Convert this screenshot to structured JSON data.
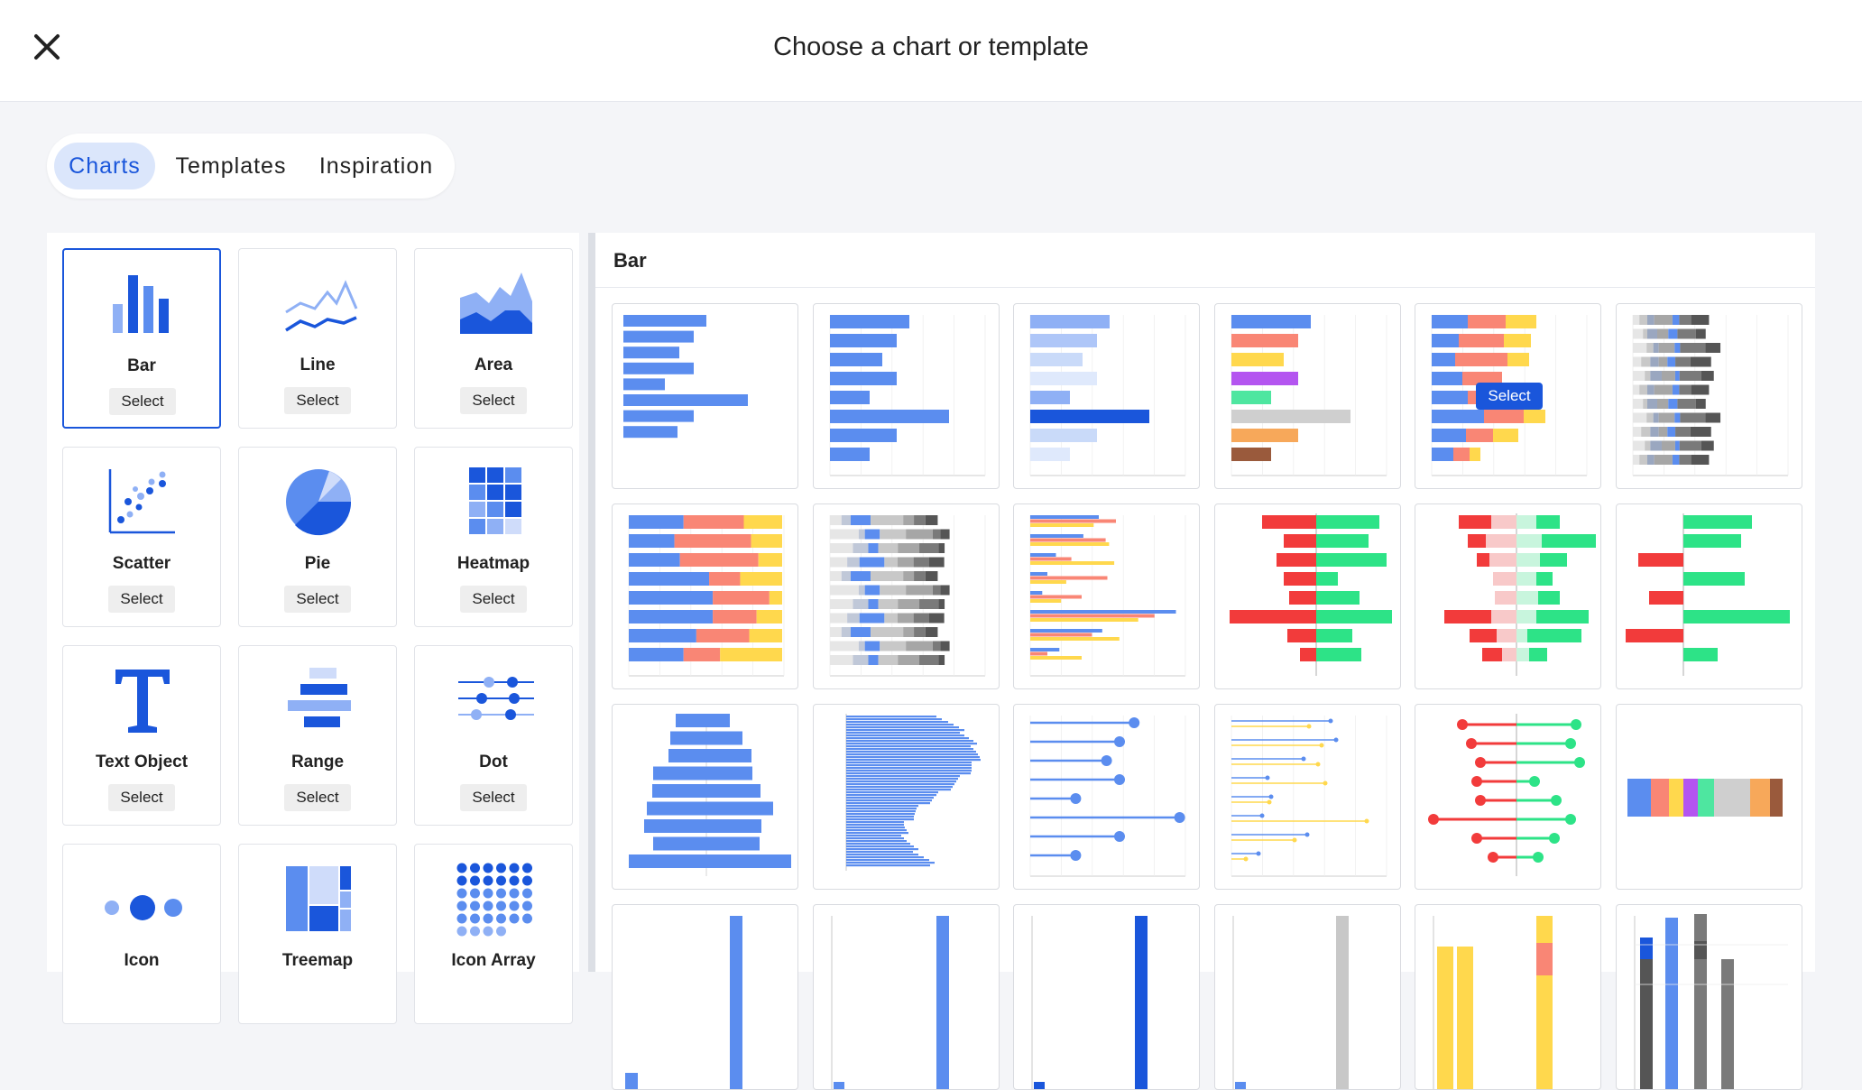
{
  "header": {
    "title": "Choose a chart or template"
  },
  "tabs": [
    {
      "label": "Charts",
      "active": true
    },
    {
      "label": "Templates",
      "active": false
    },
    {
      "label": "Inspiration",
      "active": false
    }
  ],
  "chart_types": [
    {
      "label": "Bar",
      "select_label": "Select",
      "selected": true,
      "icon": "bar-chart-icon"
    },
    {
      "label": "Line",
      "select_label": "Select",
      "icon": "line-chart-icon"
    },
    {
      "label": "Area",
      "select_label": "Select",
      "icon": "area-chart-icon"
    },
    {
      "label": "Scatter",
      "select_label": "Select",
      "icon": "scatter-chart-icon"
    },
    {
      "label": "Pie",
      "select_label": "Select",
      "icon": "pie-chart-icon"
    },
    {
      "label": "Heatmap",
      "select_label": "Select",
      "icon": "heatmap-icon"
    },
    {
      "label": "Text Object",
      "select_label": "Select",
      "icon": "text-object-icon"
    },
    {
      "label": "Range",
      "select_label": "Select",
      "icon": "range-chart-icon"
    },
    {
      "label": "Dot",
      "select_label": "Select",
      "icon": "dot-chart-icon"
    },
    {
      "label": "Icon",
      "icon": "icon-chart-icon"
    },
    {
      "label": "Treemap",
      "icon": "treemap-icon"
    },
    {
      "label": "Icon Array",
      "icon": "icon-array-icon"
    }
  ],
  "gallery": {
    "title": "Bar",
    "hover_select_label": "Select",
    "templates": [
      {
        "name": "simple-bar"
      },
      {
        "name": "bar-with-axis"
      },
      {
        "name": "bar-light-shades"
      },
      {
        "name": "bar-multicolor"
      },
      {
        "name": "stacked-bar",
        "hovered": true
      },
      {
        "name": "stacked-bar-grey"
      },
      {
        "name": "stacked-bar-100"
      },
      {
        "name": "stacked-bar-grey-100"
      },
      {
        "name": "grouped-bar"
      },
      {
        "name": "diverging-bar"
      },
      {
        "name": "diverging-stacked-bar"
      },
      {
        "name": "diverging-bar-sparse"
      },
      {
        "name": "population-pyramid"
      },
      {
        "name": "dense-bar"
      },
      {
        "name": "lollipop"
      },
      {
        "name": "grouped-lollipop"
      },
      {
        "name": "diverging-lollipop"
      },
      {
        "name": "single-stacked-bar"
      },
      {
        "name": "column"
      },
      {
        "name": "column-axis"
      },
      {
        "name": "column-dark"
      },
      {
        "name": "column-grey"
      },
      {
        "name": "stacked-column"
      },
      {
        "name": "stacked-column-grey"
      }
    ]
  },
  "colors": {
    "accent": "#1a56db",
    "bar_blue": "#5b8def",
    "red": "#f23b3b",
    "green": "#2de387",
    "yellow": "#ffd84d",
    "salmon": "#f98675"
  }
}
